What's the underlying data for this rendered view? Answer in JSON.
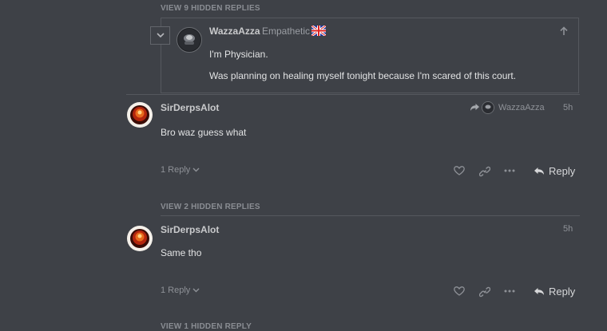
{
  "top_hidden_replies": "VIEW 9 HIDDEN REPLIES",
  "quoted_post": {
    "username": "WazzaAzza",
    "user_title": "Empathetic",
    "flag_icon": "uk-flag-icon",
    "lines": [
      "I'm Physician.",
      "Was planning on healing myself tonight because I'm scared of this court."
    ]
  },
  "posts": [
    {
      "username": "SirDerpsAlot",
      "reply_to_username": "WazzaAzza",
      "time": "5h",
      "body": "Bro waz guess what",
      "replies_label": "1 Reply",
      "reply_label": "Reply"
    },
    {
      "username": "SirDerpsAlot",
      "time": "5h",
      "body": "Same tho",
      "replies_label": "1 Reply",
      "reply_label": "Reply"
    }
  ],
  "mid_hidden_replies": "VIEW 2 HIDDEN REPLIES",
  "bottom_hidden_replies": "VIEW 1 HIDDEN REPLY",
  "colors": {
    "background": "#3e4147",
    "divider": "#55585e",
    "muted": "#8e9197"
  }
}
